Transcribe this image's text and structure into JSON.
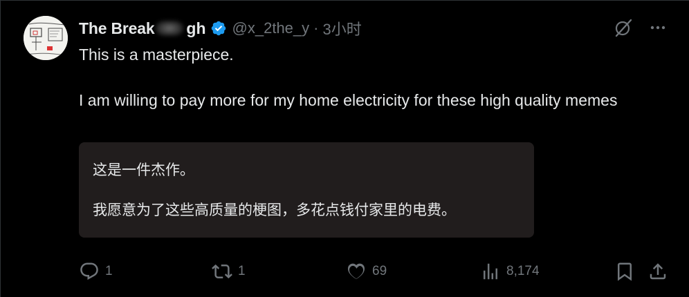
{
  "tweet": {
    "display_name": "The Break",
    "display_name_tail": "gh",
    "handle": "@x_2the_y",
    "separator": "·",
    "time": "3小时",
    "body": [
      "This is a masterpiece.",
      "I am willing to pay more for my home electricity for these high quality memes"
    ],
    "translation": [
      "这是一件杰作。",
      "我愿意为了这些高质量的梗图，多花点钱付家里的电费。"
    ],
    "counts": {
      "replies": "1",
      "retweets": "1",
      "likes": "69",
      "views": "8,174"
    }
  },
  "icons": {
    "verified": "verified-badge-icon",
    "grok": "grok-icon",
    "more": "more-icon",
    "reply": "reply-icon",
    "retweet": "retweet-icon",
    "like": "heart-icon",
    "views": "views-chart-icon",
    "bookmark": "bookmark-icon",
    "share": "share-icon"
  },
  "colors": {
    "background": "#000000",
    "text": "#e7e9ea",
    "muted": "#71767b",
    "verified": "#1d9bf0",
    "translation_bg": "#211d1d"
  }
}
